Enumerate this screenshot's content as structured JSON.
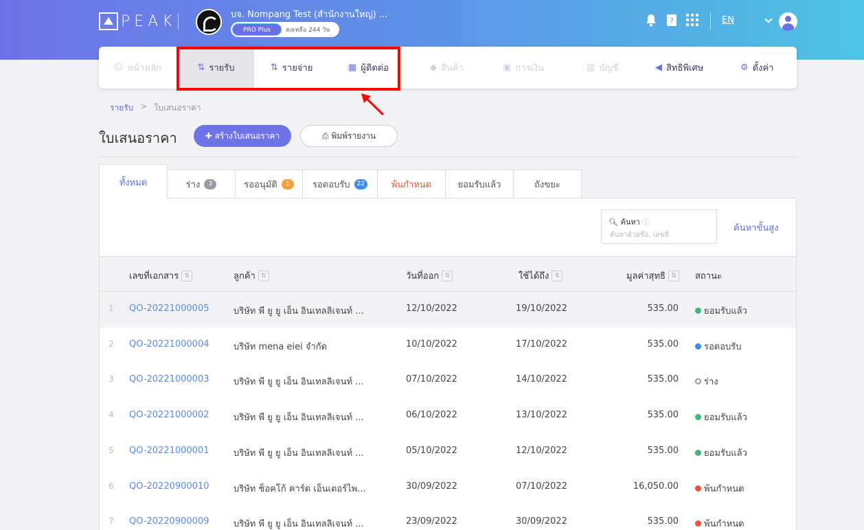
{
  "header": {
    "logo_text": "PEAK",
    "company_name": "บจ. Nompang Test (สำนักงานใหญ่) ...",
    "plan_badge": "PRO Plus",
    "plan_remaining": "คงเหลือ 244 วัน",
    "language": "EN",
    "icons": [
      "bell-icon",
      "help-icon",
      "apps-grid-icon",
      "user-icon"
    ]
  },
  "nav": {
    "items": [
      {
        "label": "หน้าหลัก",
        "icon": "home-icon",
        "state": "disabled"
      },
      {
        "label": "รายรับ",
        "icon": "income-icon",
        "state": "active"
      },
      {
        "label": "รายจ่าย",
        "icon": "expense-icon",
        "state": "enabled"
      },
      {
        "label": "ผู้ติดต่อ",
        "icon": "contacts-icon",
        "state": "enabled"
      },
      {
        "label": "สินค้า",
        "icon": "product-box-icon",
        "state": "disabled"
      },
      {
        "label": "การเงิน",
        "icon": "money-icon",
        "state": "disabled"
      },
      {
        "label": "บัญชี",
        "icon": "ledger-icon",
        "state": "disabled"
      },
      {
        "label": "สิทธิพิเศษ",
        "icon": "megaphone-icon",
        "state": "enabled"
      },
      {
        "label": "ตั้งค่า",
        "icon": "gear-icon",
        "state": "enabled"
      }
    ]
  },
  "breadcrumb": {
    "root": "รายรับ",
    "separator": ">",
    "current": "ใบเสนอราคา"
  },
  "page": {
    "title": "ใบเสนอราคา",
    "create_button": "สร้างใบเสนอราคา",
    "print_button": "พิมพ์รายงาน"
  },
  "tabs": [
    {
      "label": "ทั้งหมด",
      "count": null
    },
    {
      "label": "ร่าง",
      "count": "3",
      "badge_color": "#9a9aa6"
    },
    {
      "label": "รออนุมัติ",
      "count": "1",
      "badge_color": "#f5a03a"
    },
    {
      "label": "รอตอบรับ",
      "count": "22",
      "badge_color": "#3d8bf0"
    },
    {
      "label": "พ้นกำหนด",
      "count": null
    },
    {
      "label": "ยอมรับแล้ว",
      "count": null
    },
    {
      "label": "ถังขยะ",
      "count": null
    }
  ],
  "search": {
    "label": "ค้นหา",
    "placeholder": "ค้นหาด้วยชื่อ, เลขที่",
    "advanced": "ค้นหาขั้นสูง"
  },
  "table": {
    "columns": [
      "เลขที่เอกสาร",
      "ลูกค้า",
      "วันที่ออก",
      "ใช้ได้ถึง",
      "มูลค่าสุทธิ",
      "สถานะ"
    ],
    "rows": [
      {
        "index": "1",
        "doc": "QO-20221000005",
        "customer": "บริษัท พี ยู ยู เอ็น อินเทลลิเจนท์ ...",
        "issue": "12/10/2022",
        "valid": "19/10/2022",
        "amount": "535.00",
        "status": "ยอมรับแล้ว",
        "status_color": "#3cb878"
      },
      {
        "index": "2",
        "doc": "QO-20221000004",
        "customer": "บริษัท mena eiei จำกัด",
        "issue": "10/10/2022",
        "valid": "17/10/2022",
        "amount": "535.00",
        "status": "รอตอบรับ",
        "status_color": "#3d8bf0"
      },
      {
        "index": "3",
        "doc": "QO-20221000003",
        "customer": "บริษัท พี ยู ยู เอ็น อินเทลลิเจนท์ ...",
        "issue": "07/10/2022",
        "valid": "14/10/2022",
        "amount": "535.00",
        "status": "ร่าง",
        "status_color": "hollow"
      },
      {
        "index": "4",
        "doc": "QO-20221000002",
        "customer": "บริษัท พี ยู ยู เอ็น อินเทลลิเจนท์ ...",
        "issue": "06/10/2022",
        "valid": "13/10/2022",
        "amount": "535.00",
        "status": "ยอมรับแล้ว",
        "status_color": "#3cb878"
      },
      {
        "index": "5",
        "doc": "QO-20221000001",
        "customer": "บริษัท พี ยู ยู เอ็น อินเทลลิเจนท์ ...",
        "issue": "05/10/2022",
        "valid": "12/10/2022",
        "amount": "535.00",
        "status": "ยอมรับแล้ว",
        "status_color": "#3cb878"
      },
      {
        "index": "6",
        "doc": "QO-20220900010",
        "customer": "บริษัท ช็อคโก้ คาร์ด เอ็นเตอร์ไพ...",
        "issue": "30/09/2022",
        "valid": "07/10/2022",
        "amount": "16,050.00",
        "status": "พ้นกำหนด",
        "status_color": "#e8543f"
      },
      {
        "index": "7",
        "doc": "QO-20220900009",
        "customer": "บริษัท พี ยู ยู เอ็น อินเทลลิเจนท์ ...",
        "issue": "23/09/2022",
        "valid": "30/09/2022",
        "amount": "535.00",
        "status": "พ้นกำหนด",
        "status_color": "#e8543f"
      }
    ]
  }
}
